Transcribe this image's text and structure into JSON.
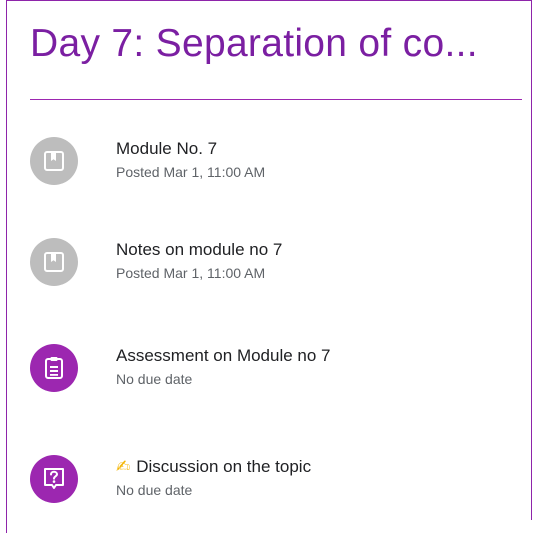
{
  "topic": {
    "title": "Day 7: Separation of co..."
  },
  "items": [
    {
      "type": "material",
      "icon": "book-icon",
      "title": "Module No. 7",
      "subtitle": "Posted Mar 1, 11:00 AM"
    },
    {
      "type": "material",
      "icon": "book-icon",
      "title": "Notes on module no 7",
      "subtitle": "Posted Mar 1, 11:00 AM"
    },
    {
      "type": "assignment",
      "icon": "clipboard-icon",
      "title": "Assessment on Module no 7",
      "subtitle": "No due date"
    },
    {
      "type": "question",
      "icon": "question-icon",
      "emoji": "✍",
      "title": "Discussion on the topic",
      "subtitle": "No due date"
    }
  ],
  "colors": {
    "accent": "#9c27b0",
    "title": "#7b1fa2",
    "material_icon_bg": "#bdbdbd"
  }
}
